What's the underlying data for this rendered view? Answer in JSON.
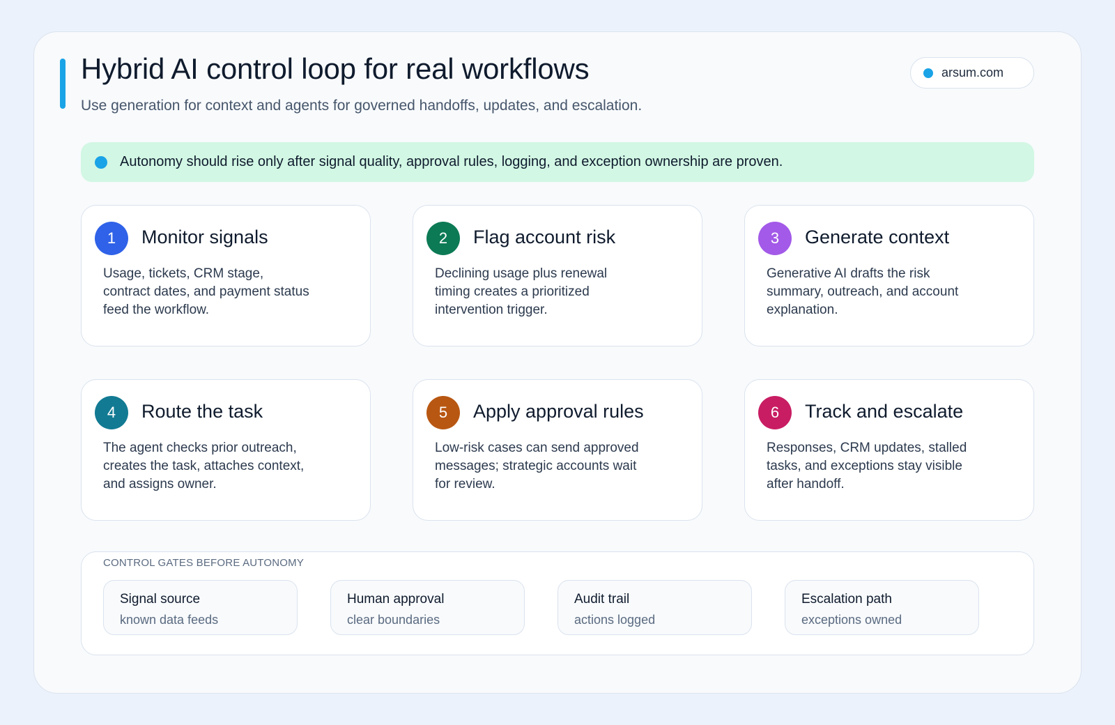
{
  "header": {
    "title": "Hybrid AI control loop for real workflows",
    "subtitle": "Use generation for context and agents for governed handoffs, updates, and escalation.",
    "domain": "arsum.com"
  },
  "notice": {
    "text": "Autonomy should rise only after signal quality, approval rules, logging, and exception ownership are proven."
  },
  "steps": [
    {
      "num": "1",
      "title": "Monitor signals",
      "desc": "Usage, tickets, CRM stage, contract dates, and payment status feed the workflow.",
      "color": "#2f62e8"
    },
    {
      "num": "2",
      "title": "Flag account risk",
      "desc": "Declining usage plus renewal timing creates a prioritized intervention trigger.",
      "color": "#0c7a55"
    },
    {
      "num": "3",
      "title": "Generate context",
      "desc": "Generative AI drafts the risk summary, outreach, and account explanation.",
      "color": "#a35ae8"
    },
    {
      "num": "4",
      "title": "Route the task",
      "desc": "The agent checks prior outreach, creates the task, attaches context, and assigns owner.",
      "color": "#127a93"
    },
    {
      "num": "5",
      "title": "Apply approval rules",
      "desc": "Low-risk cases can send approved messages; strategic accounts wait for review.",
      "color": "#b85712"
    },
    {
      "num": "6",
      "title": "Track and escalate",
      "desc": "Responses, CRM updates, stalled tasks, and exceptions stay visible after handoff.",
      "color": "#c81d63"
    }
  ],
  "gates": {
    "label": "CONTROL GATES BEFORE AUTONOMY",
    "items": [
      {
        "title": "Signal source",
        "sub": "known data feeds"
      },
      {
        "title": "Human approval",
        "sub": "clear boundaries"
      },
      {
        "title": "Audit trail",
        "sub": "actions logged"
      },
      {
        "title": "Escalation path",
        "sub": "exceptions owned"
      }
    ]
  },
  "colors": {
    "accent": "#1aa3e6",
    "notice_bg": "#d2f7e4"
  }
}
